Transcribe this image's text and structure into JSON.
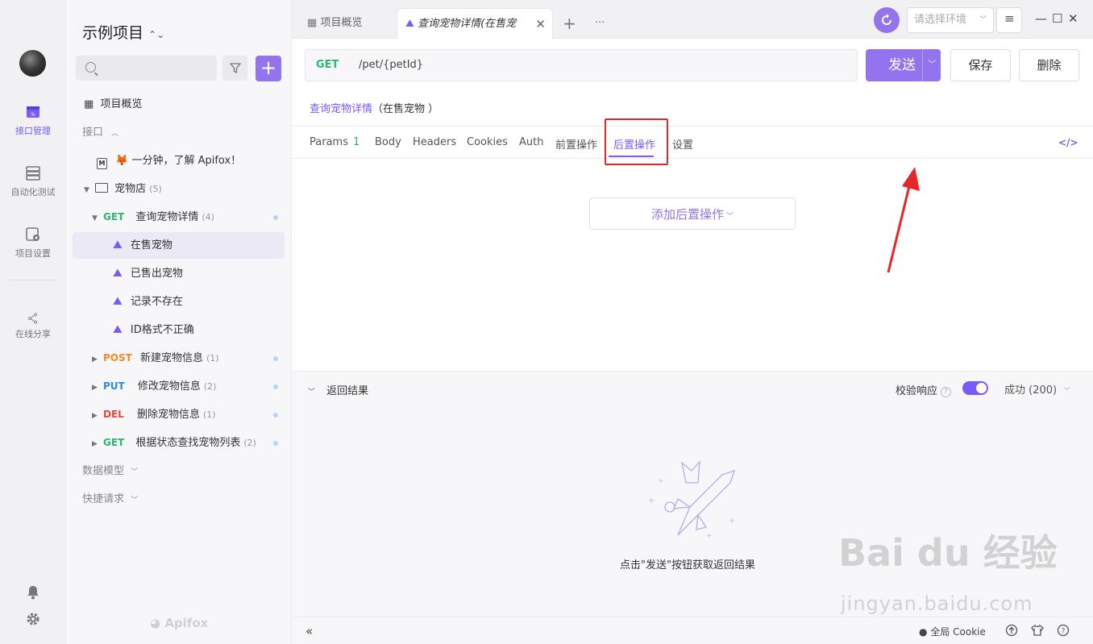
{
  "rail": {
    "items": [
      {
        "label": "接口管理",
        "icon": "api-icon",
        "active": true
      },
      {
        "label": "自动化测试",
        "icon": "automation-icon",
        "active": false
      },
      {
        "label": "项目设置",
        "icon": "project-settings-icon",
        "active": false
      },
      {
        "label": "在线分享",
        "icon": "share-icon",
        "active": false
      }
    ]
  },
  "sidebar": {
    "project_name": "示例项目",
    "overview_label": "项目概览",
    "api_section": "接口",
    "tree": {
      "intro": "🦊 一分钟，了解 Apifox！",
      "folder": {
        "name": "宠物店",
        "count": "(5)"
      },
      "endpoints": [
        {
          "method": "GET",
          "name": "查询宠物详情",
          "count": "(4)"
        },
        {
          "method": "POST",
          "name": "新建宠物信息",
          "count": "(1)"
        },
        {
          "method": "PUT",
          "name": "修改宠物信息",
          "count": "(2)"
        },
        {
          "method": "DEL",
          "name": "删除宠物信息",
          "count": "(1)"
        },
        {
          "method": "GET",
          "name": "根据状态查找宠物列表",
          "count": "(2)"
        }
      ],
      "cases": [
        "在售宠物",
        "已售出宠物",
        "记录不存在",
        "ID格式不正确"
      ]
    },
    "data_model": "数据模型",
    "quick_request": "快捷请求",
    "logo": "Apifox"
  },
  "tabs": {
    "overview": "项目概览",
    "current": "查询宠物详情(在售宠"
  },
  "env_placeholder": "请选择环境",
  "request": {
    "method": "GET",
    "path": "/pet/{petId}",
    "send": "发送",
    "save": "保存",
    "delete": "删除",
    "title_link": "查询宠物详情",
    "title_case": "（在售宠物 ）"
  },
  "subtabs": {
    "params": "Params",
    "params_count": "1",
    "body": "Body",
    "headers": "Headers",
    "cookies": "Cookies",
    "auth": "Auth",
    "pre": "前置操作",
    "post": "后置操作",
    "settings": "设置"
  },
  "add_post_op": "添加后置操作",
  "result": {
    "title": "返回结果",
    "verify": "校验响应",
    "status": "成功 (200)",
    "empty": "点击\"发送\"按钮获取返回结果"
  },
  "bottom": {
    "cookie": "全局 Cookie"
  },
  "colors": {
    "accent": "#7a5af8",
    "get": "#2bb673",
    "post": "#f08a24",
    "put": "#2a8ce6",
    "del": "#e5483c",
    "highlight": "#e8262a"
  },
  "watermark": {
    "main": "Bai du 经验",
    "sub": "jingyan.baidu.com"
  }
}
